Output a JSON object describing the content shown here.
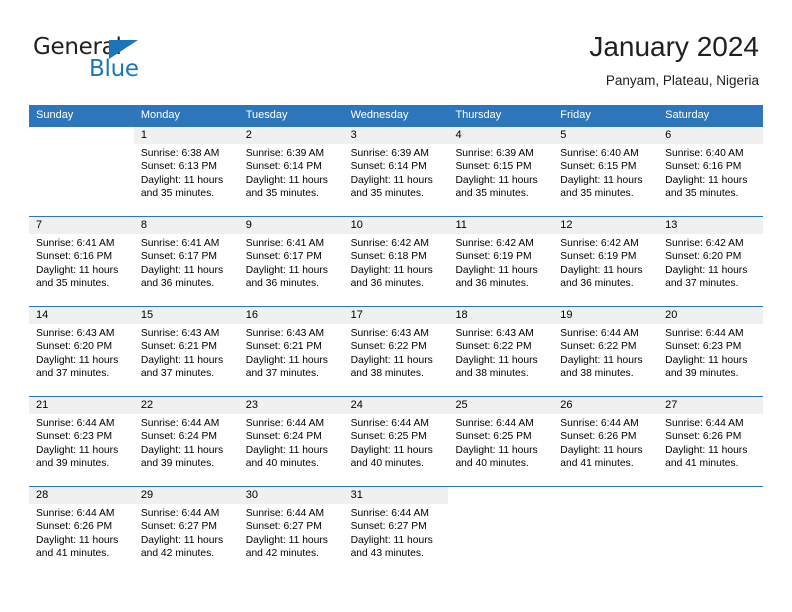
{
  "logo": {
    "word_one": "General",
    "word_two": "Blue",
    "triangle_color": "#1b75bb",
    "text_color": "#231f20"
  },
  "header": {
    "title": "January 2024",
    "subtitle": "Panyam, Plateau, Nigeria"
  },
  "colors": {
    "header_blue": "#2e76bc",
    "daynum_band": "#f0f0f0",
    "text": "#000000",
    "header_text": "#ffffff"
  },
  "calendar": {
    "day_headers": [
      "Sunday",
      "Monday",
      "Tuesday",
      "Wednesday",
      "Thursday",
      "Friday",
      "Saturday"
    ],
    "weeks": [
      [
        {
          "day": "",
          "sunrise": "",
          "sunset": "",
          "daylight_1": "",
          "daylight_2": ""
        },
        {
          "day": "1",
          "sunrise": "Sunrise: 6:38 AM",
          "sunset": "Sunset: 6:13 PM",
          "daylight_1": "Daylight: 11 hours",
          "daylight_2": "and 35 minutes."
        },
        {
          "day": "2",
          "sunrise": "Sunrise: 6:39 AM",
          "sunset": "Sunset: 6:14 PM",
          "daylight_1": "Daylight: 11 hours",
          "daylight_2": "and 35 minutes."
        },
        {
          "day": "3",
          "sunrise": "Sunrise: 6:39 AM",
          "sunset": "Sunset: 6:14 PM",
          "daylight_1": "Daylight: 11 hours",
          "daylight_2": "and 35 minutes."
        },
        {
          "day": "4",
          "sunrise": "Sunrise: 6:39 AM",
          "sunset": "Sunset: 6:15 PM",
          "daylight_1": "Daylight: 11 hours",
          "daylight_2": "and 35 minutes."
        },
        {
          "day": "5",
          "sunrise": "Sunrise: 6:40 AM",
          "sunset": "Sunset: 6:15 PM",
          "daylight_1": "Daylight: 11 hours",
          "daylight_2": "and 35 minutes."
        },
        {
          "day": "6",
          "sunrise": "Sunrise: 6:40 AM",
          "sunset": "Sunset: 6:16 PM",
          "daylight_1": "Daylight: 11 hours",
          "daylight_2": "and 35 minutes."
        }
      ],
      [
        {
          "day": "7",
          "sunrise": "Sunrise: 6:41 AM",
          "sunset": "Sunset: 6:16 PM",
          "daylight_1": "Daylight: 11 hours",
          "daylight_2": "and 35 minutes."
        },
        {
          "day": "8",
          "sunrise": "Sunrise: 6:41 AM",
          "sunset": "Sunset: 6:17 PM",
          "daylight_1": "Daylight: 11 hours",
          "daylight_2": "and 36 minutes."
        },
        {
          "day": "9",
          "sunrise": "Sunrise: 6:41 AM",
          "sunset": "Sunset: 6:17 PM",
          "daylight_1": "Daylight: 11 hours",
          "daylight_2": "and 36 minutes."
        },
        {
          "day": "10",
          "sunrise": "Sunrise: 6:42 AM",
          "sunset": "Sunset: 6:18 PM",
          "daylight_1": "Daylight: 11 hours",
          "daylight_2": "and 36 minutes."
        },
        {
          "day": "11",
          "sunrise": "Sunrise: 6:42 AM",
          "sunset": "Sunset: 6:19 PM",
          "daylight_1": "Daylight: 11 hours",
          "daylight_2": "and 36 minutes."
        },
        {
          "day": "12",
          "sunrise": "Sunrise: 6:42 AM",
          "sunset": "Sunset: 6:19 PM",
          "daylight_1": "Daylight: 11 hours",
          "daylight_2": "and 36 minutes."
        },
        {
          "day": "13",
          "sunrise": "Sunrise: 6:42 AM",
          "sunset": "Sunset: 6:20 PM",
          "daylight_1": "Daylight: 11 hours",
          "daylight_2": "and 37 minutes."
        }
      ],
      [
        {
          "day": "14",
          "sunrise": "Sunrise: 6:43 AM",
          "sunset": "Sunset: 6:20 PM",
          "daylight_1": "Daylight: 11 hours",
          "daylight_2": "and 37 minutes."
        },
        {
          "day": "15",
          "sunrise": "Sunrise: 6:43 AM",
          "sunset": "Sunset: 6:21 PM",
          "daylight_1": "Daylight: 11 hours",
          "daylight_2": "and 37 minutes."
        },
        {
          "day": "16",
          "sunrise": "Sunrise: 6:43 AM",
          "sunset": "Sunset: 6:21 PM",
          "daylight_1": "Daylight: 11 hours",
          "daylight_2": "and 37 minutes."
        },
        {
          "day": "17",
          "sunrise": "Sunrise: 6:43 AM",
          "sunset": "Sunset: 6:22 PM",
          "daylight_1": "Daylight: 11 hours",
          "daylight_2": "and 38 minutes."
        },
        {
          "day": "18",
          "sunrise": "Sunrise: 6:43 AM",
          "sunset": "Sunset: 6:22 PM",
          "daylight_1": "Daylight: 11 hours",
          "daylight_2": "and 38 minutes."
        },
        {
          "day": "19",
          "sunrise": "Sunrise: 6:44 AM",
          "sunset": "Sunset: 6:22 PM",
          "daylight_1": "Daylight: 11 hours",
          "daylight_2": "and 38 minutes."
        },
        {
          "day": "20",
          "sunrise": "Sunrise: 6:44 AM",
          "sunset": "Sunset: 6:23 PM",
          "daylight_1": "Daylight: 11 hours",
          "daylight_2": "and 39 minutes."
        }
      ],
      [
        {
          "day": "21",
          "sunrise": "Sunrise: 6:44 AM",
          "sunset": "Sunset: 6:23 PM",
          "daylight_1": "Daylight: 11 hours",
          "daylight_2": "and 39 minutes."
        },
        {
          "day": "22",
          "sunrise": "Sunrise: 6:44 AM",
          "sunset": "Sunset: 6:24 PM",
          "daylight_1": "Daylight: 11 hours",
          "daylight_2": "and 39 minutes."
        },
        {
          "day": "23",
          "sunrise": "Sunrise: 6:44 AM",
          "sunset": "Sunset: 6:24 PM",
          "daylight_1": "Daylight: 11 hours",
          "daylight_2": "and 40 minutes."
        },
        {
          "day": "24",
          "sunrise": "Sunrise: 6:44 AM",
          "sunset": "Sunset: 6:25 PM",
          "daylight_1": "Daylight: 11 hours",
          "daylight_2": "and 40 minutes."
        },
        {
          "day": "25",
          "sunrise": "Sunrise: 6:44 AM",
          "sunset": "Sunset: 6:25 PM",
          "daylight_1": "Daylight: 11 hours",
          "daylight_2": "and 40 minutes."
        },
        {
          "day": "26",
          "sunrise": "Sunrise: 6:44 AM",
          "sunset": "Sunset: 6:26 PM",
          "daylight_1": "Daylight: 11 hours",
          "daylight_2": "and 41 minutes."
        },
        {
          "day": "27",
          "sunrise": "Sunrise: 6:44 AM",
          "sunset": "Sunset: 6:26 PM",
          "daylight_1": "Daylight: 11 hours",
          "daylight_2": "and 41 minutes."
        }
      ],
      [
        {
          "day": "28",
          "sunrise": "Sunrise: 6:44 AM",
          "sunset": "Sunset: 6:26 PM",
          "daylight_1": "Daylight: 11 hours",
          "daylight_2": "and 41 minutes."
        },
        {
          "day": "29",
          "sunrise": "Sunrise: 6:44 AM",
          "sunset": "Sunset: 6:27 PM",
          "daylight_1": "Daylight: 11 hours",
          "daylight_2": "and 42 minutes."
        },
        {
          "day": "30",
          "sunrise": "Sunrise: 6:44 AM",
          "sunset": "Sunset: 6:27 PM",
          "daylight_1": "Daylight: 11 hours",
          "daylight_2": "and 42 minutes."
        },
        {
          "day": "31",
          "sunrise": "Sunrise: 6:44 AM",
          "sunset": "Sunset: 6:27 PM",
          "daylight_1": "Daylight: 11 hours",
          "daylight_2": "and 43 minutes."
        },
        {
          "day": "",
          "sunrise": "",
          "sunset": "",
          "daylight_1": "",
          "daylight_2": ""
        },
        {
          "day": "",
          "sunrise": "",
          "sunset": "",
          "daylight_1": "",
          "daylight_2": ""
        },
        {
          "day": "",
          "sunrise": "",
          "sunset": "",
          "daylight_1": "",
          "daylight_2": ""
        }
      ]
    ]
  }
}
